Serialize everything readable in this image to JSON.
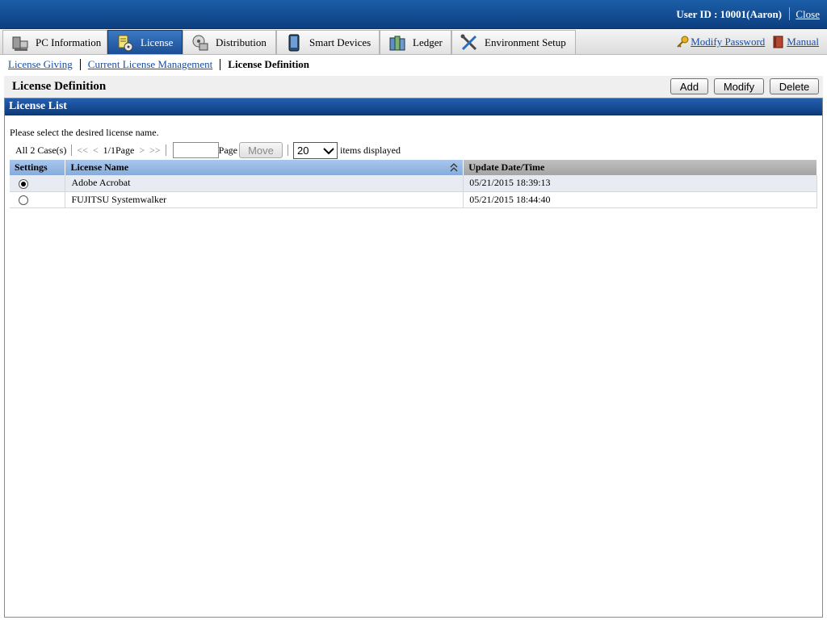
{
  "topbar": {
    "user_label": "User ID : 10001(Aaron)",
    "close_label": "Close"
  },
  "tabs": [
    {
      "label": "PC Information",
      "icon": "pc-icon"
    },
    {
      "label": "License",
      "icon": "license-icon",
      "active": true
    },
    {
      "label": "Distribution",
      "icon": "distribution-icon"
    },
    {
      "label": "Smart Devices",
      "icon": "smart-device-icon"
    },
    {
      "label": "Ledger",
      "icon": "ledger-icon"
    },
    {
      "label": "Environment Setup",
      "icon": "tools-icon"
    }
  ],
  "toplinks": {
    "modify_password": "Modify Password",
    "manual": "Manual"
  },
  "breadcrumb": {
    "item1": "License Giving",
    "item2": "Current License Management",
    "current": "License Definition"
  },
  "header": {
    "title": "License Definition",
    "add": "Add",
    "modify": "Modify",
    "delete": "Delete"
  },
  "panel": {
    "title": "License List",
    "hint": "Please select the desired license name.",
    "pager": {
      "total": "All 2 Case(s)",
      "first": "<<",
      "prev": "<",
      "page_info": "1/1Page",
      "next": ">",
      "last": ">>",
      "page_value": "",
      "page_label": "Page",
      "move": "Move",
      "per_page": "20",
      "items_label": "items displayed"
    },
    "columns": {
      "settings": "Settings",
      "name": "License Name",
      "date": "Update Date/Time"
    },
    "rows": [
      {
        "name": "Adobe Acrobat",
        "date": "05/21/2015 18:39:13",
        "selected": true
      },
      {
        "name": "FUJITSU Systemwalker",
        "date": "05/21/2015 18:44:40",
        "selected": false
      }
    ]
  },
  "colors": {
    "header_blue": "#0d3f80",
    "link": "#1a4ea0",
    "table_header": "#a9c7ec"
  }
}
